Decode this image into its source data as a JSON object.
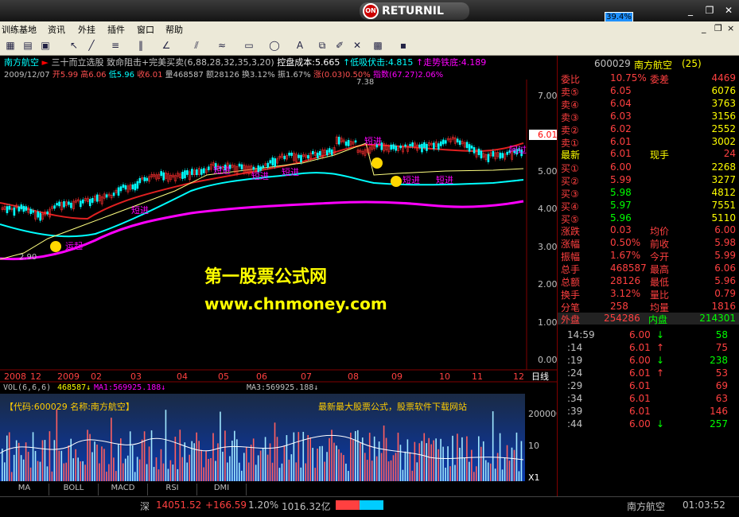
{
  "window": {
    "logo_text": "RETURNIL",
    "logo_badge": "ON",
    "pct_badge": "39.4%",
    "min": "_",
    "restore": "❐",
    "close": "✕"
  },
  "menu": [
    "训练基地",
    "资讯",
    "外挂",
    "插件",
    "窗口",
    "帮助"
  ],
  "menu_controls": [
    "_",
    "❐",
    "×"
  ],
  "header": {
    "stock_name": "南方航空",
    "formula": "三十而立选股 致命阻击+完美买卖(6,88,28,32,35,3,20)",
    "cost": "控盘成本:5.665",
    "low_absorb": "↑低吸伏击:4.815",
    "bottom": "↑走势铁底:4.189",
    "date": "2009/12/07",
    "open": "开5.99",
    "high": "高6.06",
    "low": "低5.96",
    "close": "收6.01",
    "volume": "量468587",
    "amount": "额28126",
    "turnover": "换3.12%",
    "amplitude": "振1.67%",
    "change": "涨(0.03)0.50%",
    "index": "指数(67.27)2.06%"
  },
  "watermark": {
    "line1": "第一股票公式网",
    "line2": "www.chnmoney.com"
  },
  "price_axis": [
    "7.00",
    "6.00",
    "5.00",
    "4.00",
    "3.00",
    "2.00",
    "1.00",
    "0.00"
  ],
  "price_tag": "6.01",
  "peak_label": "7.38",
  "trough_label": "2.90",
  "signal_labels": [
    "短进",
    "短进",
    "短进",
    "短进",
    "短进",
    "短进",
    "短进",
    "短进",
    "运起",
    "阿过"
  ],
  "time_axis": [
    "2008",
    "12",
    "2009",
    "02",
    "03",
    "04",
    "05",
    "06",
    "07",
    "08",
    "09",
    "10",
    "11",
    "12"
  ],
  "time_axis_end": "日线",
  "vol_header": {
    "vol": "VOL(6,6,6)",
    "vol_val": "468587↓",
    "ma1": "MA1:569925.188↓",
    "ma3": "MA3:569925.188↓"
  },
  "code_line": "【代码:600029 名称:南方航空】",
  "ad_line": "最新最大股票公式，股票软件下载网站",
  "vol_axis": [
    "200000",
    "10"
  ],
  "vol_axis_unit": "X1",
  "tabs": [
    "MA",
    "BOLL",
    "MACD",
    "RSI",
    "DMI"
  ],
  "right_panel": {
    "code": "600029",
    "name": "南方航空",
    "rank": "(25)",
    "weibi_label": "委比",
    "weibi_val": "10.75%",
    "weicha_label": "委差",
    "weicha_val": "4469",
    "sells": [
      {
        "label": "卖⑤",
        "price": "6.05",
        "vol": "6076"
      },
      {
        "label": "卖④",
        "price": "6.04",
        "vol": "3763"
      },
      {
        "label": "卖③",
        "price": "6.03",
        "vol": "3156"
      },
      {
        "label": "卖②",
        "price": "6.02",
        "vol": "2552"
      },
      {
        "label": "卖①",
        "price": "6.01",
        "vol": "3002"
      }
    ],
    "latest_label": "最新",
    "latest_val": "6.01",
    "xianshou_label": "现手",
    "xianshou_val": "24",
    "buys": [
      {
        "label": "买①",
        "price": "6.00",
        "vol": "2268"
      },
      {
        "label": "买②",
        "price": "5.99",
        "vol": "3277"
      },
      {
        "label": "买③",
        "price": "5.98",
        "vol": "4812"
      },
      {
        "label": "买④",
        "price": "5.97",
        "vol": "7551"
      },
      {
        "label": "买⑤",
        "price": "5.96",
        "vol": "5110"
      }
    ],
    "stats": [
      {
        "l1": "涨跌",
        "v1": "0.03",
        "l2": "均价",
        "v2": "6.00"
      },
      {
        "l1": "涨幅",
        "v1": "0.50%",
        "l2": "前收",
        "v2": "5.98"
      },
      {
        "l1": "振幅",
        "v1": "1.67%",
        "l2": "今开",
        "v2": "5.99"
      },
      {
        "l1": "总手",
        "v1": "468587",
        "l2": "最高",
        "v2": "6.06"
      },
      {
        "l1": "总额",
        "v1": "28126",
        "l2": "最低",
        "v2": "5.96"
      },
      {
        "l1": "换手",
        "v1": "3.12%",
        "l2": "量比",
        "v2": "0.79"
      },
      {
        "l1": "分笔",
        "v1": "258",
        "l2": "均量",
        "v2": "1816"
      }
    ],
    "waipan_label": "外盘",
    "waipan_val": "254286",
    "neipan_label": "内盘",
    "neipan_val": "214301",
    "ticks": [
      {
        "t": "14:59",
        "p": "6.00",
        "a": "↓",
        "v": "58"
      },
      {
        "t": ":14",
        "p": "6.01",
        "a": "↑",
        "v": "75"
      },
      {
        "t": ":19",
        "p": "6.00",
        "a": "↓",
        "v": "238"
      },
      {
        "t": ":24",
        "p": "6.01",
        "a": "↑",
        "v": "53"
      },
      {
        "t": ":29",
        "p": "6.01",
        "a": "",
        "v": "69"
      },
      {
        "t": ":34",
        "p": "6.01",
        "a": "",
        "v": "63"
      },
      {
        "t": ":39",
        "p": "6.01",
        "a": "",
        "v": "146"
      },
      {
        "t": ":44",
        "p": "6.00",
        "a": "↓",
        "v": "257"
      }
    ]
  },
  "status": {
    "market": "深",
    "index": "14051.52",
    "change": "+166.59",
    "pct": "1.20%",
    "amount": "1016.32亿",
    "stock": "南方航空",
    "time": "01:03:52"
  }
}
